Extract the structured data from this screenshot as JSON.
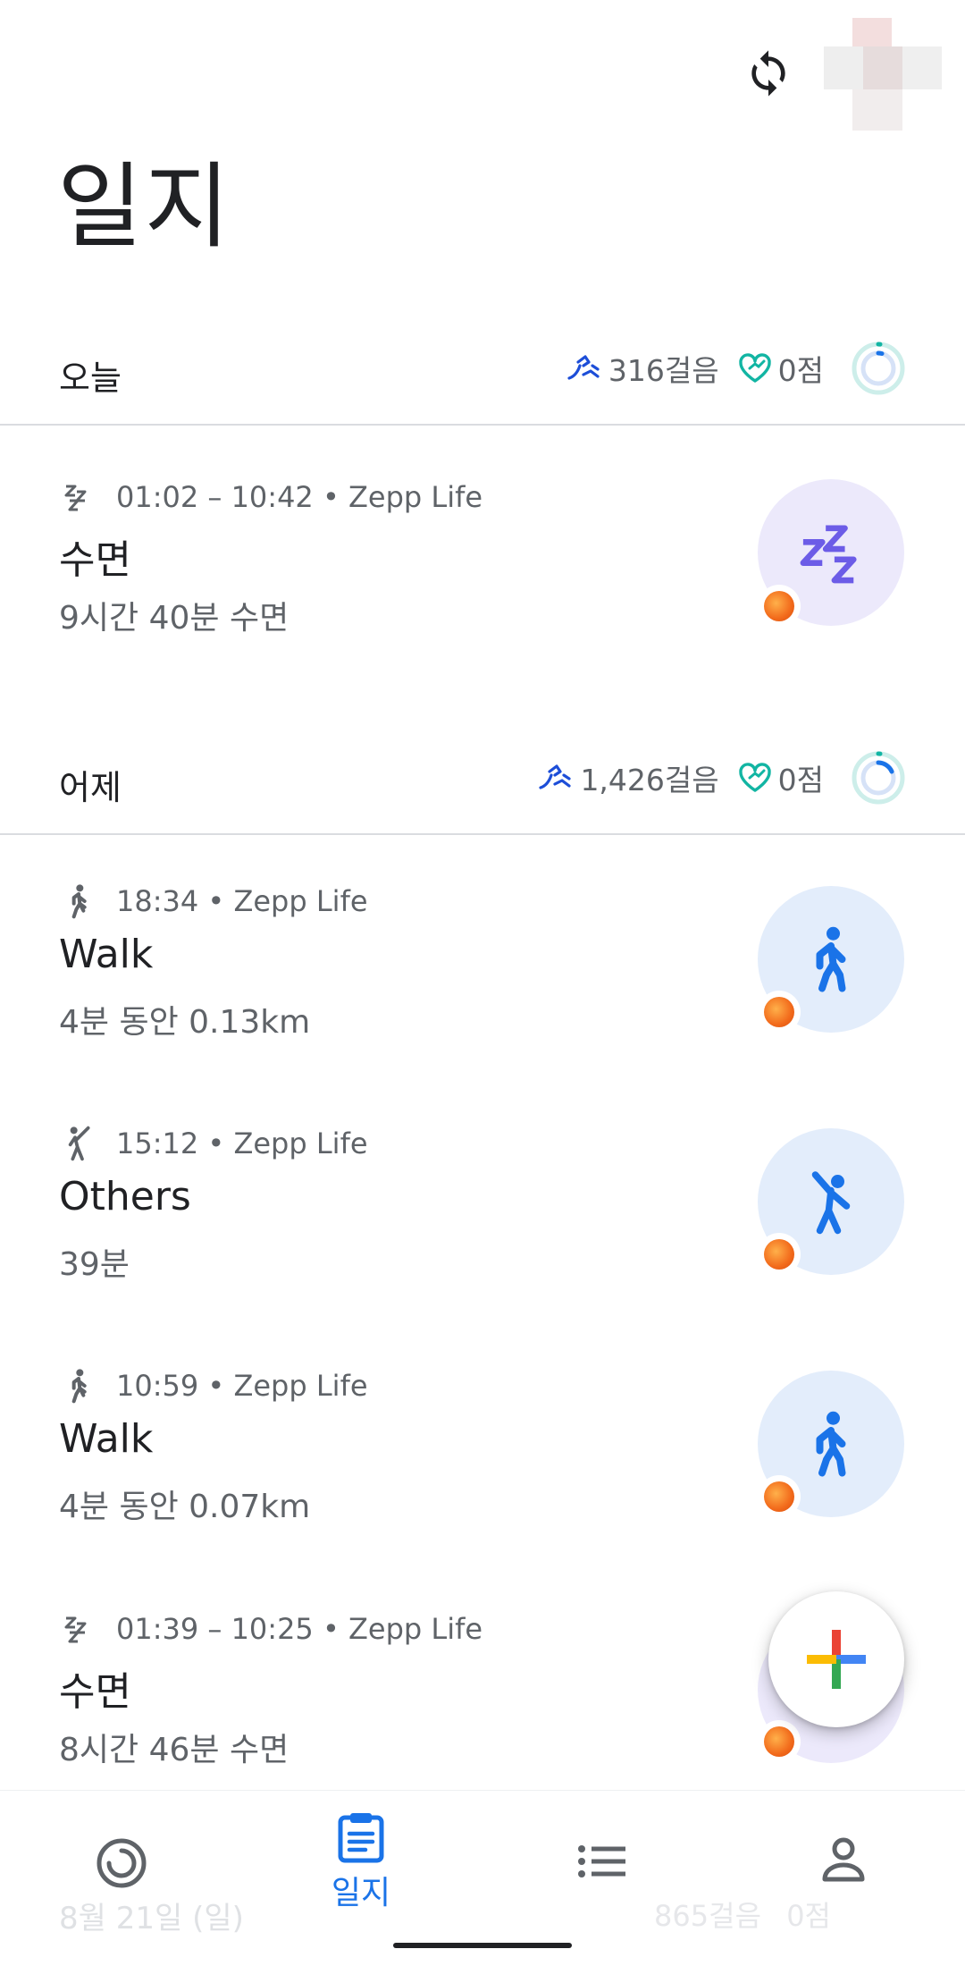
{
  "header": {
    "title": "일지",
    "sync_icon": "sync-icon",
    "avatar": "avatar"
  },
  "days": [
    {
      "label": "오늘",
      "steps": "316걸음",
      "heart_points": "0점",
      "entries": [
        {
          "icon": "sleep-icon",
          "meta": "01:02 – 10:42 • Zepp Life",
          "title": "수면",
          "detail": "9시간 40분 수면",
          "kind": "sleep"
        }
      ]
    },
    {
      "label": "어제",
      "steps": "1,426걸음",
      "heart_points": "0점",
      "entries": [
        {
          "icon": "walk-icon",
          "meta": "18:34 • Zepp Life",
          "title": "Walk",
          "detail": "4분 동안 0.13km",
          "kind": "walk"
        },
        {
          "icon": "others-icon",
          "meta": "15:12 • Zepp Life",
          "title": "Others",
          "detail": "39분",
          "kind": "others"
        },
        {
          "icon": "walk-icon",
          "meta": "10:59 • Zepp Life",
          "title": "Walk",
          "detail": "4분 동안 0.07km",
          "kind": "walk"
        },
        {
          "icon": "sleep-icon",
          "meta": "01:39 – 10:25 • Zepp Life",
          "title": "수면",
          "detail": "8시간 46분 수면",
          "kind": "sleep"
        }
      ]
    }
  ],
  "next_day_partial": {
    "label": "8월 21일 (일)",
    "steps": "865걸음",
    "heart_points": "0점"
  },
  "fab": {
    "icon": "add-icon"
  },
  "nav": {
    "items": [
      {
        "icon": "home-ring-icon",
        "label": ""
      },
      {
        "icon": "journal-icon",
        "label": "일지",
        "active": true
      },
      {
        "icon": "browse-list-icon",
        "label": ""
      },
      {
        "icon": "profile-icon",
        "label": ""
      }
    ]
  },
  "colors": {
    "accent": "#1a73e8",
    "sleep_bg": "#ece9fb",
    "sleep_icon": "#6c5ce7",
    "activity_bg": "#e3edfb",
    "activity_icon": "#1a73e8",
    "steps_icon": "#1d4ed8",
    "heart_icon": "#12b5a3"
  }
}
